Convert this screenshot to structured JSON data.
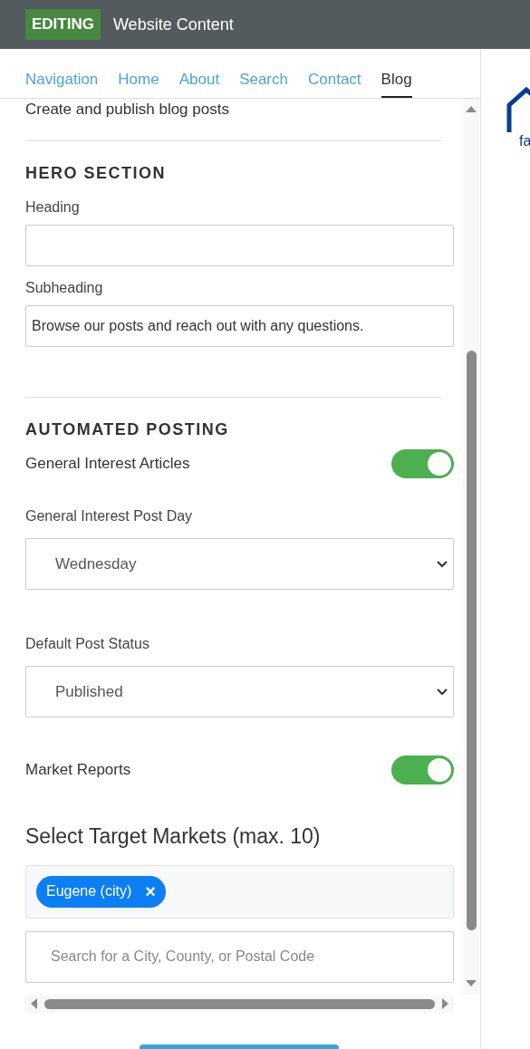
{
  "header": {
    "badge": "EDITING",
    "title": "Website Content"
  },
  "tabs": [
    {
      "label": "Navigation",
      "selected": false
    },
    {
      "label": "Home",
      "selected": false
    },
    {
      "label": "About",
      "selected": false
    },
    {
      "label": "Search",
      "selected": false
    },
    {
      "label": "Contact",
      "selected": false
    },
    {
      "label": "Blog",
      "selected": true
    }
  ],
  "intro_text": "Create and publish blog posts",
  "hero_section": {
    "title": "HERO SECTION",
    "fields": [
      {
        "label": "Heading"
      },
      {
        "label": "Subheading",
        "value": "Browse our posts and reach out with any questions."
      }
    ]
  },
  "automated_posting": {
    "title": "AUTOMATED POSTING",
    "items": [
      {
        "kind": "toggle",
        "label": "General Interest Articles",
        "on": true
      },
      {
        "kind": "select",
        "label": "General Interest Post Day",
        "value": "Wednesday"
      },
      {
        "kind": "select",
        "label": "Default Post Status",
        "value": "Published"
      },
      {
        "kind": "toggle",
        "label": "Market Reports",
        "on": true
      }
    ]
  },
  "target_markets": {
    "title": "Select Target Markets (max. 10)",
    "tags": [
      {
        "label": "Eugene (city)",
        "remove": "×"
      }
    ],
    "search": {
      "placeholder": "Search for a City, County, or Postal Code"
    }
  },
  "preview": {
    "logo_text": "fa"
  }
}
